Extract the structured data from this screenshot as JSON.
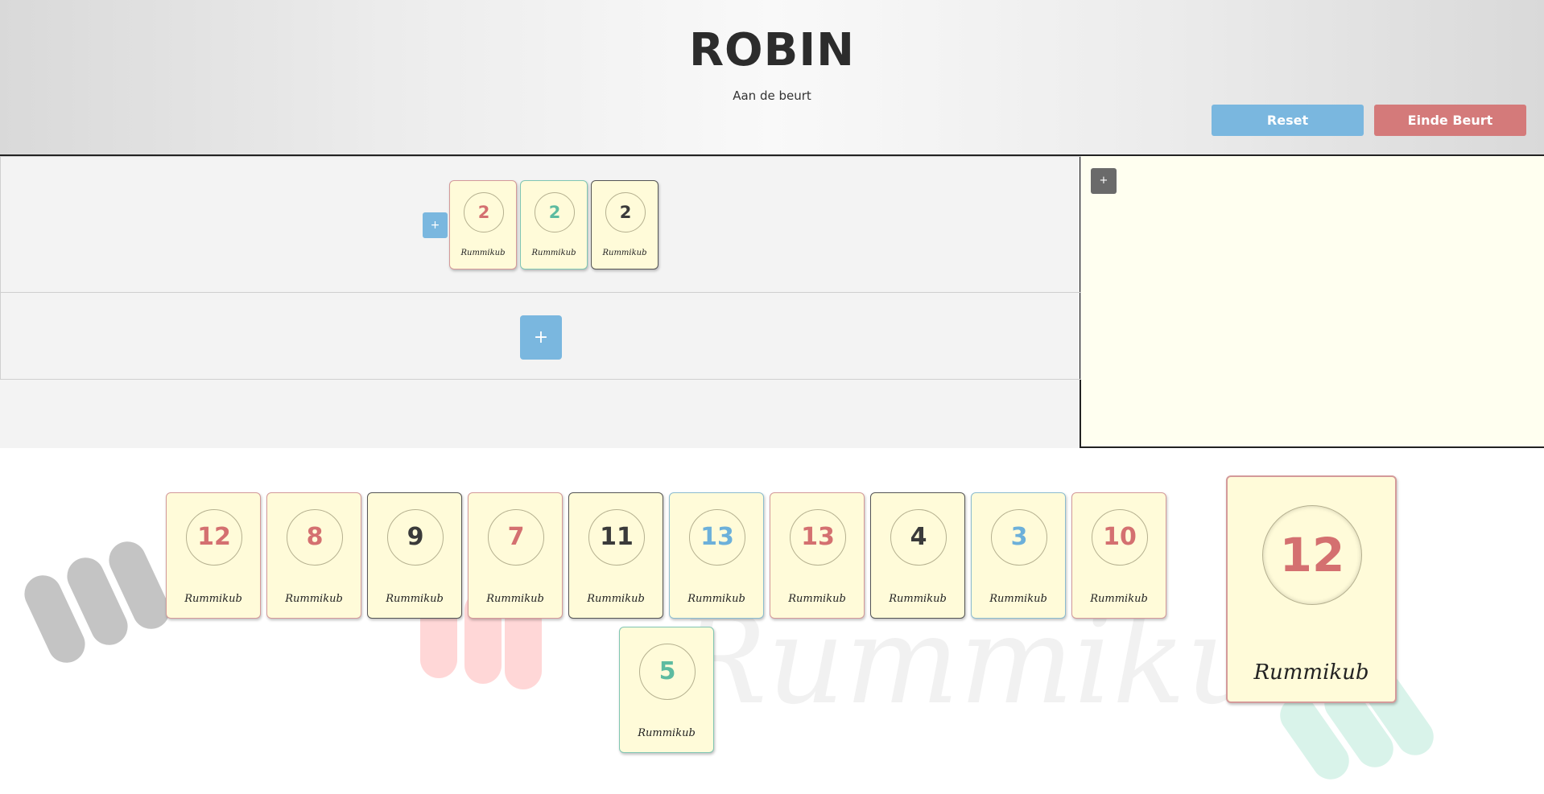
{
  "header": {
    "player_name": "ROBIN",
    "turn_text": "Aan de beurt",
    "reset_label": "Reset",
    "end_turn_label": "Einde Beurt"
  },
  "board": {
    "add_label": "+",
    "sets": [
      {
        "tiles": [
          {
            "number": "2",
            "color": "red",
            "brand": "Rummikub"
          },
          {
            "number": "2",
            "color": "green",
            "brand": "Rummikub"
          },
          {
            "number": "2",
            "color": "black",
            "brand": "Rummikub"
          }
        ]
      }
    ]
  },
  "side_panel": {
    "add_label": "+"
  },
  "rack": {
    "tiles": [
      {
        "number": "12",
        "color": "red",
        "brand": "Rummikub"
      },
      {
        "number": "8",
        "color": "red",
        "brand": "Rummikub"
      },
      {
        "number": "9",
        "color": "black",
        "brand": "Rummikub"
      },
      {
        "number": "7",
        "color": "red",
        "brand": "Rummikub"
      },
      {
        "number": "11",
        "color": "black",
        "brand": "Rummikub"
      },
      {
        "number": "13",
        "color": "blue",
        "brand": "Rummikub"
      },
      {
        "number": "13",
        "color": "red",
        "brand": "Rummikub"
      },
      {
        "number": "4",
        "color": "black",
        "brand": "Rummikub"
      },
      {
        "number": "3",
        "color": "blue",
        "brand": "Rummikub"
      },
      {
        "number": "10",
        "color": "red",
        "brand": "Rummikub"
      },
      {
        "number": "5",
        "color": "green",
        "brand": "Rummikub"
      }
    ]
  },
  "selected_tile": {
    "number": "12",
    "color": "red",
    "brand": "Rummikub"
  },
  "watermark": "Rummikub",
  "colors": {
    "red": "#d47070",
    "green": "#5dbba0",
    "black": "#3a3a3a",
    "blue": "#6cb0da",
    "tile_bg": "#fffbd9",
    "button_blue": "#7ab7df",
    "button_red": "#d47a7a"
  }
}
